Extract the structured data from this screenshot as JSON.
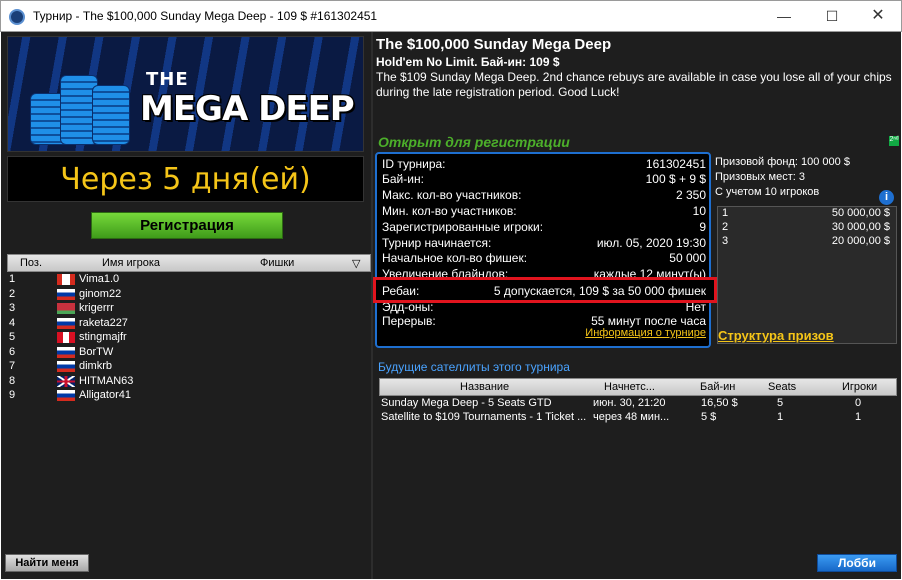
{
  "window": {
    "title": "Турнир - The $100,000 Sunday Mega Deep - 109 $ #161302451",
    "min_glyph": "—",
    "max_glyph": "☐",
    "close_glyph": "✕"
  },
  "banner": {
    "logo_the": "THE",
    "logo_main": "MEGA DEEP"
  },
  "countdown": "Через 5 дня(ей)",
  "register_button": "Регистрация",
  "players": {
    "columns": [
      "Поз.",
      "Имя игрока",
      "Фишки"
    ],
    "sort_icon": "▽",
    "rows": [
      {
        "pos": "1",
        "name": "Vima1.0",
        "flag": "CA"
      },
      {
        "pos": "2",
        "name": "ginom22",
        "flag": "RU"
      },
      {
        "pos": "3",
        "name": "krigerrr",
        "flag": "BY"
      },
      {
        "pos": "4",
        "name": "raketa227",
        "flag": "RU"
      },
      {
        "pos": "5",
        "name": "stingmajfr",
        "flag": "PE"
      },
      {
        "pos": "6",
        "name": "BorTW",
        "flag": "RU"
      },
      {
        "pos": "7",
        "name": "dimkrb",
        "flag": "RU"
      },
      {
        "pos": "8",
        "name": "HITMAN63",
        "flag": "GB"
      },
      {
        "pos": "9",
        "name": "Alligator41",
        "flag": "RU"
      }
    ]
  },
  "find_me_button": "Найти меня",
  "tournament": {
    "title": "The $100,000 Sunday Mega Deep",
    "subtitle": "Hold'em No Limit. Бай-ин: 109 $",
    "description": "The $109 Sunday Mega Deep. 2nd chance rebuys are available in case you lose all of your chips during the late registration period. Good Luck!",
    "status": "Открыт для регистрации",
    "status_icon": "2ⁿᵈ"
  },
  "info": {
    "rows": [
      {
        "label": "ID турнира:",
        "value": "161302451"
      },
      {
        "label": "Бай-ин:",
        "value": "100 $ + 9 $"
      },
      {
        "label": "Макс. кол-во участников:",
        "value": "2 350"
      },
      {
        "label": "Мин. кол-во участников:",
        "value": "10"
      },
      {
        "label": "Зарегистрированные игроки:",
        "value": "9"
      },
      {
        "label": "Турнир начинается:",
        "value": "июл. 05, 2020 19:30"
      },
      {
        "label": "Начальное кол-во фишек:",
        "value": "50 000"
      },
      {
        "label": "Увеличение блайндов:",
        "value": "каждые 12 минут(ы)"
      },
      {
        "label": "Эдд-оны:",
        "value": "Нет"
      },
      {
        "label": "Перерыв:",
        "value": "55 минут после часа"
      }
    ],
    "rebuy_label": "Ребаи:",
    "rebuy_value": "5 допускается, 109 $ за 50 000 фишек",
    "info_link": "Информация о турнире"
  },
  "prize": {
    "pool": "Призовой фонд: 100 000 $",
    "places": "Призовых мест: 3",
    "note": "С учетом 10 игроков",
    "info_icon": "i",
    "rows": [
      {
        "place": "1",
        "amount": "50 000,00 $"
      },
      {
        "place": "2",
        "amount": "30 000,00 $"
      },
      {
        "place": "3",
        "amount": "20 000,00 $"
      }
    ],
    "structure_link": "Структура призов"
  },
  "satellites": {
    "title": "Будущие сателлиты этого турнира",
    "columns": [
      "Название",
      "Начнетс...",
      "Бай-ин",
      "Seats",
      "Игроки"
    ],
    "rows": [
      {
        "name": "Sunday Mega Deep - 5 Seats GTD",
        "start": "июн. 30, 21:20",
        "buyin": "16,50 $",
        "seats": "5",
        "players": "0"
      },
      {
        "name": "Satellite to $109 Tournaments - 1 Ticket ...",
        "start": "через 48 мин...",
        "buyin": "5 $",
        "seats": "1",
        "players": "1"
      }
    ]
  },
  "lobby_button": "Лобби"
}
